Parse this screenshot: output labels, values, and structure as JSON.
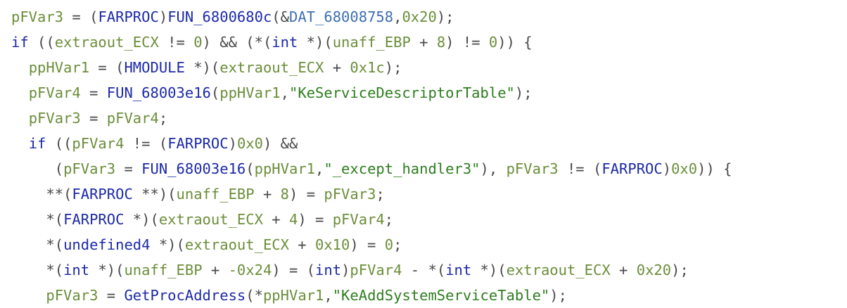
{
  "decompiler": {
    "colors": {
      "variable": "#6b8e3a",
      "function": "#1d2aa8",
      "type": "#1d2aa8",
      "keyword": "#1d2aa8",
      "number": "#6b8e3a",
      "string": "#2e7d1f",
      "global": "#3d6fb0",
      "operator": "#4a4a4a",
      "background": "#ffffff"
    },
    "lines": [
      [
        {
          "t": "pFVar3",
          "k": "var"
        },
        {
          "t": " = (",
          "k": "op"
        },
        {
          "t": "FARPROC",
          "k": "type"
        },
        {
          "t": ")",
          "k": "punc"
        },
        {
          "t": "FUN_6800680c",
          "k": "func"
        },
        {
          "t": "(&",
          "k": "punc"
        },
        {
          "t": "DAT_68008758",
          "k": "global"
        },
        {
          "t": ",",
          "k": "punc"
        },
        {
          "t": "0x20",
          "k": "num"
        },
        {
          "t": ");",
          "k": "punc"
        }
      ],
      [
        {
          "t": "if",
          "k": "kw"
        },
        {
          "t": " ((",
          "k": "punc"
        },
        {
          "t": "extraout_ECX",
          "k": "var"
        },
        {
          "t": " != ",
          "k": "op"
        },
        {
          "t": "0",
          "k": "num"
        },
        {
          "t": ") && (*(",
          "k": "punc"
        },
        {
          "t": "int",
          "k": "type"
        },
        {
          "t": " *)(",
          "k": "punc"
        },
        {
          "t": "unaff_EBP",
          "k": "var"
        },
        {
          "t": " + ",
          "k": "op"
        },
        {
          "t": "8",
          "k": "num"
        },
        {
          "t": ") != ",
          "k": "op"
        },
        {
          "t": "0",
          "k": "num"
        },
        {
          "t": ")) {",
          "k": "punc"
        }
      ],
      [
        {
          "t": "  ",
          "k": "op"
        },
        {
          "t": "ppHVar1",
          "k": "var"
        },
        {
          "t": " = (",
          "k": "op"
        },
        {
          "t": "HMODULE",
          "k": "type"
        },
        {
          "t": " *)(",
          "k": "punc"
        },
        {
          "t": "extraout_ECX",
          "k": "var"
        },
        {
          "t": " + ",
          "k": "op"
        },
        {
          "t": "0x1c",
          "k": "num"
        },
        {
          "t": ");",
          "k": "punc"
        }
      ],
      [
        {
          "t": "  ",
          "k": "op"
        },
        {
          "t": "pFVar4",
          "k": "var"
        },
        {
          "t": " = ",
          "k": "op"
        },
        {
          "t": "FUN_68003e16",
          "k": "func"
        },
        {
          "t": "(",
          "k": "punc"
        },
        {
          "t": "ppHVar1",
          "k": "var"
        },
        {
          "t": ",",
          "k": "punc"
        },
        {
          "t": "\"KeServiceDescriptorTable\"",
          "k": "str"
        },
        {
          "t": ");",
          "k": "punc"
        }
      ],
      [
        {
          "t": "  ",
          "k": "op"
        },
        {
          "t": "pFVar3",
          "k": "var"
        },
        {
          "t": " = ",
          "k": "op"
        },
        {
          "t": "pFVar4",
          "k": "var"
        },
        {
          "t": ";",
          "k": "punc"
        }
      ],
      [
        {
          "t": "  ",
          "k": "op"
        },
        {
          "t": "if",
          "k": "kw"
        },
        {
          "t": " ((",
          "k": "punc"
        },
        {
          "t": "pFVar4",
          "k": "var"
        },
        {
          "t": " != (",
          "k": "op"
        },
        {
          "t": "FARPROC",
          "k": "type"
        },
        {
          "t": ")",
          "k": "punc"
        },
        {
          "t": "0x0",
          "k": "num"
        },
        {
          "t": ") &&",
          "k": "punc"
        }
      ],
      [
        {
          "t": "     (",
          "k": "punc"
        },
        {
          "t": "pFVar3",
          "k": "var"
        },
        {
          "t": " = ",
          "k": "op"
        },
        {
          "t": "FUN_68003e16",
          "k": "func"
        },
        {
          "t": "(",
          "k": "punc"
        },
        {
          "t": "ppHVar1",
          "k": "var"
        },
        {
          "t": ",",
          "k": "punc"
        },
        {
          "t": "\"_except_handler3\"",
          "k": "str"
        },
        {
          "t": "), ",
          "k": "punc"
        },
        {
          "t": "pFVar3",
          "k": "var"
        },
        {
          "t": " != (",
          "k": "op"
        },
        {
          "t": "FARPROC",
          "k": "type"
        },
        {
          "t": ")",
          "k": "punc"
        },
        {
          "t": "0x0",
          "k": "num"
        },
        {
          "t": ")) {",
          "k": "punc"
        }
      ],
      [
        {
          "t": "    **(",
          "k": "punc"
        },
        {
          "t": "FARPROC",
          "k": "type"
        },
        {
          "t": " **)(",
          "k": "punc"
        },
        {
          "t": "unaff_EBP",
          "k": "var"
        },
        {
          "t": " + ",
          "k": "op"
        },
        {
          "t": "8",
          "k": "num"
        },
        {
          "t": ") = ",
          "k": "op"
        },
        {
          "t": "pFVar3",
          "k": "var"
        },
        {
          "t": ";",
          "k": "punc"
        }
      ],
      [
        {
          "t": "    *(",
          "k": "punc"
        },
        {
          "t": "FARPROC",
          "k": "type"
        },
        {
          "t": " *)(",
          "k": "punc"
        },
        {
          "t": "extraout_ECX",
          "k": "var"
        },
        {
          "t": " + ",
          "k": "op"
        },
        {
          "t": "4",
          "k": "num"
        },
        {
          "t": ") = ",
          "k": "op"
        },
        {
          "t": "pFVar4",
          "k": "var"
        },
        {
          "t": ";",
          "k": "punc"
        }
      ],
      [
        {
          "t": "    *(",
          "k": "punc"
        },
        {
          "t": "undefined4",
          "k": "type"
        },
        {
          "t": " *)(",
          "k": "punc"
        },
        {
          "t": "extraout_ECX",
          "k": "var"
        },
        {
          "t": " + ",
          "k": "op"
        },
        {
          "t": "0x10",
          "k": "num"
        },
        {
          "t": ") = ",
          "k": "op"
        },
        {
          "t": "0",
          "k": "num"
        },
        {
          "t": ";",
          "k": "punc"
        }
      ],
      [
        {
          "t": "    *(",
          "k": "punc"
        },
        {
          "t": "int",
          "k": "type"
        },
        {
          "t": " *)(",
          "k": "punc"
        },
        {
          "t": "unaff_EBP",
          "k": "var"
        },
        {
          "t": " + ",
          "k": "op"
        },
        {
          "t": "-0x24",
          "k": "num"
        },
        {
          "t": ") = (",
          "k": "op"
        },
        {
          "t": "int",
          "k": "type"
        },
        {
          "t": ")",
          "k": "punc"
        },
        {
          "t": "pFVar4",
          "k": "var"
        },
        {
          "t": " - *(",
          "k": "op"
        },
        {
          "t": "int",
          "k": "type"
        },
        {
          "t": " *)(",
          "k": "punc"
        },
        {
          "t": "extraout_ECX",
          "k": "var"
        },
        {
          "t": " + ",
          "k": "op"
        },
        {
          "t": "0x20",
          "k": "num"
        },
        {
          "t": ");",
          "k": "punc"
        }
      ],
      [
        {
          "t": "    ",
          "k": "op"
        },
        {
          "t": "pFVar3",
          "k": "var"
        },
        {
          "t": " = ",
          "k": "op"
        },
        {
          "t": "GetProcAddress",
          "k": "func"
        },
        {
          "t": "(*",
          "k": "punc"
        },
        {
          "t": "ppHVar1",
          "k": "var"
        },
        {
          "t": ",",
          "k": "punc"
        },
        {
          "t": "\"KeAddSystemServiceTable\"",
          "k": "str"
        },
        {
          "t": ");",
          "k": "punc"
        }
      ]
    ]
  }
}
